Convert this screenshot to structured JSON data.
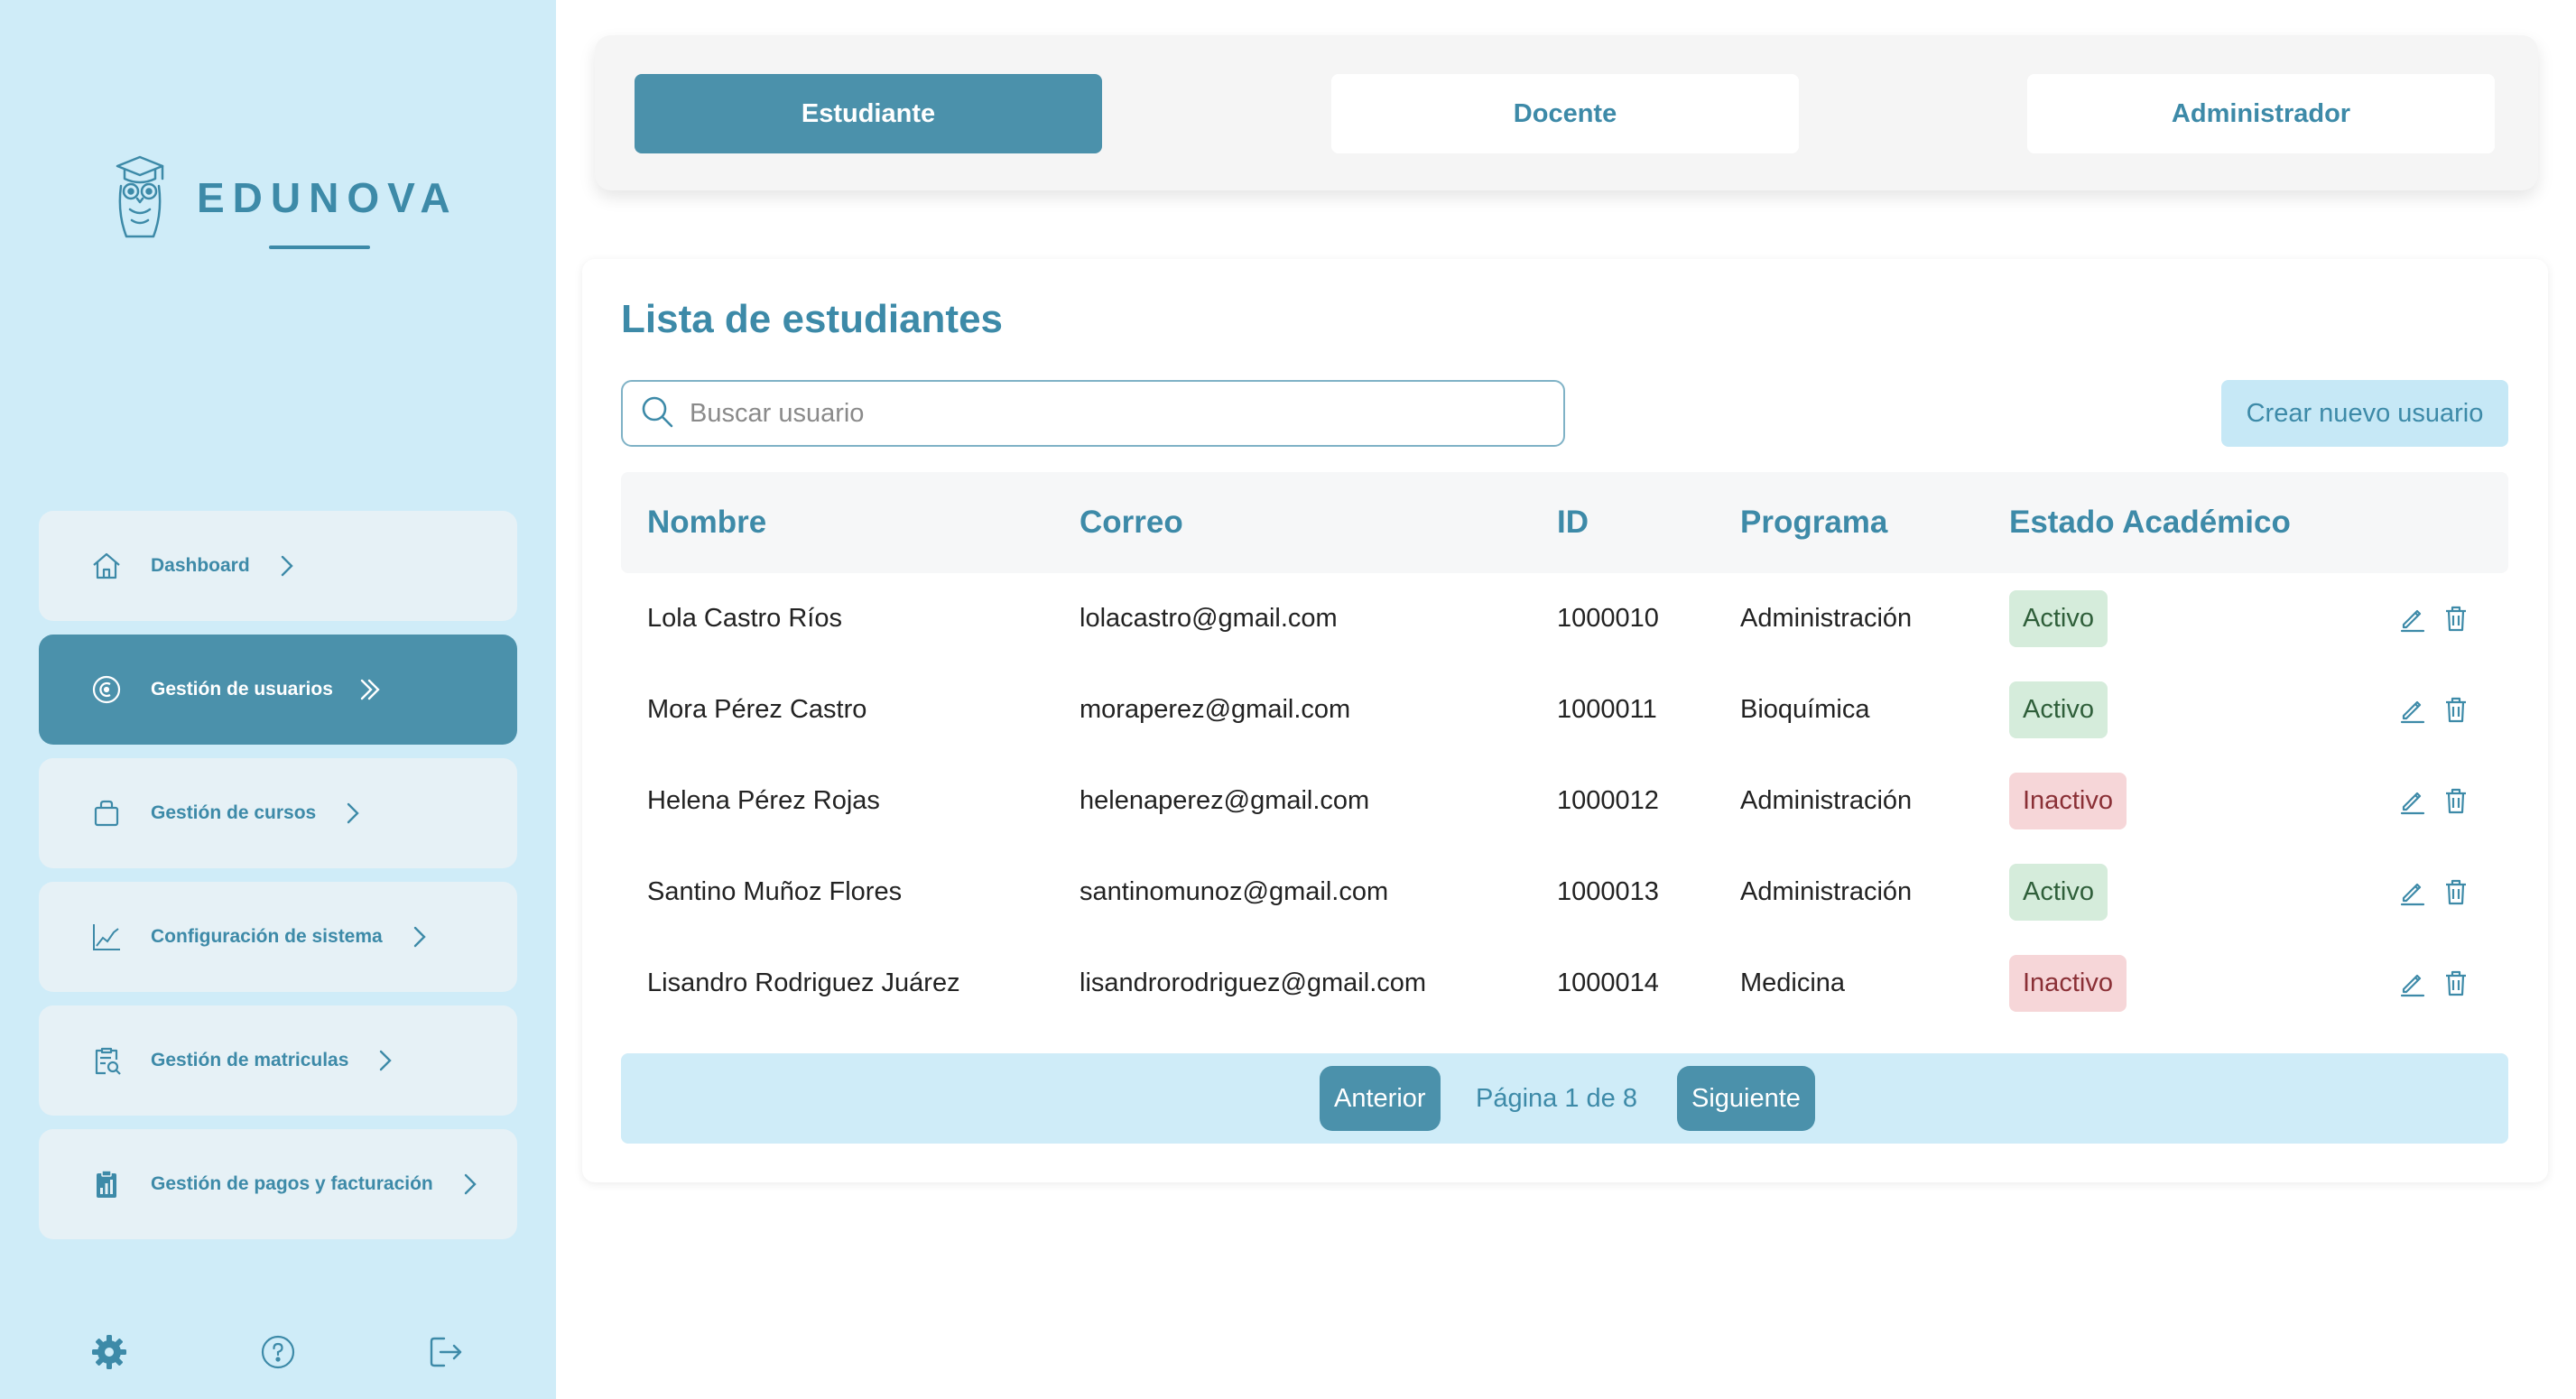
{
  "brand": {
    "name": "EDUNOVA",
    "logo_icon": "owl-graduate-icon"
  },
  "sidebar": {
    "items": [
      {
        "label": "Dashboard",
        "icon": "home-icon",
        "active": false
      },
      {
        "label": "Gestión de usuarios",
        "icon": "users-circle-icon",
        "active": true
      },
      {
        "label": "Gestión de cursos",
        "icon": "bag-icon",
        "active": false
      },
      {
        "label": "Configuración de sistema",
        "icon": "line-chart-icon",
        "active": false
      },
      {
        "label": "Gestión de matriculas",
        "icon": "clipboard-search-icon",
        "active": false
      },
      {
        "label": "Gestión de pagos y facturación",
        "icon": "billing-clipboard-icon",
        "active": false
      }
    ],
    "footer": [
      "settings-gear-icon",
      "help-circle-icon",
      "logout-icon"
    ]
  },
  "roles": {
    "tabs": [
      {
        "label": "Estudiante",
        "selected": true
      },
      {
        "label": "Docente",
        "selected": false
      },
      {
        "label": "Administrador",
        "selected": false
      }
    ]
  },
  "main": {
    "title": "Lista de estudiantes",
    "search": {
      "placeholder": "Buscar usuario"
    },
    "create_button": "Crear nuevo usuario"
  },
  "table": {
    "headers": [
      "Nombre",
      "Correo",
      "ID",
      "Programa",
      "Estado Académico"
    ],
    "rows": [
      {
        "name": "Lola Castro Ríos",
        "email": "lolacastro@gmail.com",
        "id": "1000010",
        "program": "Administración",
        "status": "Activo"
      },
      {
        "name": "Mora Pérez Castro",
        "email": "moraperez@gmail.com",
        "id": "1000011",
        "program": "Bioquímica",
        "status": "Activo"
      },
      {
        "name": "Helena Pérez Rojas",
        "email": "helenaperez@gmail.com",
        "id": "1000012",
        "program": "Administración",
        "status": "Inactivo"
      },
      {
        "name": "Santino Muñoz Flores",
        "email": "santinomunoz@gmail.com",
        "id": "1000013",
        "program": "Administración",
        "status": "Activo"
      },
      {
        "name": "Lisandro Rodriguez Juárez",
        "email": "lisandrorodriguez@gmail.com",
        "id": "1000014",
        "program": "Medicina",
        "status": "Inactivo"
      }
    ]
  },
  "pagination": {
    "prev": "Anterior",
    "info": "Página 1 de 8",
    "next": "Siguiente"
  },
  "colors": {
    "primary": "#4b91ab",
    "accent_text": "#3d8aa8",
    "sidebar_bg": "#cfecf8",
    "active_badge": "#d5ecdb",
    "inactive_badge": "#f6d6d8"
  }
}
